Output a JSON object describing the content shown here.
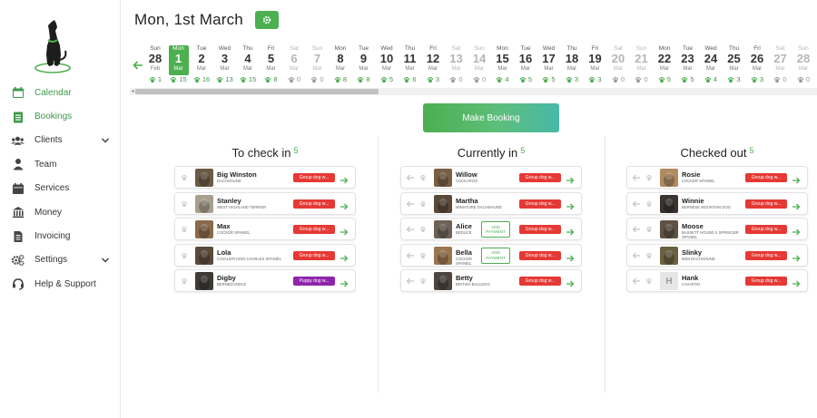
{
  "header": {
    "date_title": "Mon, 1st March"
  },
  "sidebar": {
    "items": [
      {
        "label": "Calendar",
        "icon": "calendar-icon",
        "active": true
      },
      {
        "label": "Bookings",
        "icon": "clipboard-icon",
        "active": true
      },
      {
        "label": "Clients",
        "icon": "users-icon",
        "expandable": true
      },
      {
        "label": "Team",
        "icon": "user-icon"
      },
      {
        "label": "Services",
        "icon": "services-calendar-icon"
      },
      {
        "label": "Money",
        "icon": "bank-icon"
      },
      {
        "label": "Invoicing",
        "icon": "invoice-icon"
      },
      {
        "label": "Settings",
        "icon": "cogs-icon",
        "expandable": true
      },
      {
        "label": "Help & Support",
        "icon": "headset-icon"
      }
    ]
  },
  "calendar": {
    "days": [
      {
        "dn": "Sun",
        "num": "28",
        "mo": "Feb",
        "count": "1",
        "weekend": false
      },
      {
        "dn": "Mon",
        "num": "1",
        "mo": "Mar",
        "count": "15",
        "selected": true
      },
      {
        "dn": "Tue",
        "num": "2",
        "mo": "Mar",
        "count": "16"
      },
      {
        "dn": "Wed",
        "num": "3",
        "mo": "Mar",
        "count": "13"
      },
      {
        "dn": "Thu",
        "num": "4",
        "mo": "Mar",
        "count": "15"
      },
      {
        "dn": "Fri",
        "num": "5",
        "mo": "Mar",
        "count": "8"
      },
      {
        "dn": "Sat",
        "num": "6",
        "mo": "Mar",
        "count": "0",
        "weekend": true
      },
      {
        "dn": "Sun",
        "num": "7",
        "mo": "Mar",
        "count": "0",
        "weekend": true
      },
      {
        "dn": "Mon",
        "num": "8",
        "mo": "Mar",
        "count": "8"
      },
      {
        "dn": "Tue",
        "num": "9",
        "mo": "Mar",
        "count": "8"
      },
      {
        "dn": "Wed",
        "num": "10",
        "mo": "Mar",
        "count": "5"
      },
      {
        "dn": "Thu",
        "num": "11",
        "mo": "Mar",
        "count": "6"
      },
      {
        "dn": "Fri",
        "num": "12",
        "mo": "Mar",
        "count": "3"
      },
      {
        "dn": "Sat",
        "num": "13",
        "mo": "Mar",
        "count": "0",
        "weekend": true
      },
      {
        "dn": "Sun",
        "num": "14",
        "mo": "Mar",
        "count": "0",
        "weekend": true
      },
      {
        "dn": "Mon",
        "num": "15",
        "mo": "Mar",
        "count": "4"
      },
      {
        "dn": "Tue",
        "num": "16",
        "mo": "Mar",
        "count": "5"
      },
      {
        "dn": "Wed",
        "num": "17",
        "mo": "Mar",
        "count": "5"
      },
      {
        "dn": "Thu",
        "num": "18",
        "mo": "Mar",
        "count": "3"
      },
      {
        "dn": "Fri",
        "num": "19",
        "mo": "Mar",
        "count": "3"
      },
      {
        "dn": "Sat",
        "num": "20",
        "mo": "Mar",
        "count": "0",
        "weekend": true
      },
      {
        "dn": "Sun",
        "num": "21",
        "mo": "Mar",
        "count": "0",
        "weekend": true
      },
      {
        "dn": "Mon",
        "num": "22",
        "mo": "Mar",
        "count": "5"
      },
      {
        "dn": "Tue",
        "num": "23",
        "mo": "Mar",
        "count": "5"
      },
      {
        "dn": "Wed",
        "num": "24",
        "mo": "Mar",
        "count": "4"
      },
      {
        "dn": "Thu",
        "num": "25",
        "mo": "Mar",
        "count": "3"
      },
      {
        "dn": "Fri",
        "num": "26",
        "mo": "Mar",
        "count": "3"
      },
      {
        "dn": "Sat",
        "num": "27",
        "mo": "Mar",
        "count": "0",
        "weekend": true
      },
      {
        "dn": "Sun",
        "num": "28",
        "mo": "Mar",
        "count": "0",
        "weekend": true
      }
    ]
  },
  "actions": {
    "make_booking": "Make Booking"
  },
  "columns": [
    {
      "title": "To check in",
      "count": "5",
      "cards": [
        {
          "name": "Big Winston",
          "breed": "Dachshund",
          "service": "Group dog w...",
          "photo": "#6b5a44"
        },
        {
          "name": "Stanley",
          "breed": "West Highland Terrier",
          "service": "Group dog w...",
          "photo": "#a89f8e"
        },
        {
          "name": "Max",
          "breed": "Cocker Spaniel",
          "service": "Group dog w...",
          "photo": "#8a6a4a"
        },
        {
          "name": "Lola",
          "breed": "Cavalier King Charles Spaniel",
          "service": "Group dog w...",
          "photo": "#5b4a3a"
        },
        {
          "name": "Digby",
          "breed": "Bernedoodle",
          "service": "Puppy dog w...",
          "photo": "#3e3a36",
          "puppy": true
        }
      ]
    },
    {
      "title": "Currently in",
      "count": "5",
      "cards": [
        {
          "name": "Willow",
          "breed": "Cockapoo",
          "service": "Group dog w...",
          "photo": "#7a5f45"
        },
        {
          "name": "Martha",
          "breed": "Miniature Dachshund",
          "service": "Group dog w...",
          "photo": "#5a4838"
        },
        {
          "name": "Alice",
          "breed": "Beduce",
          "service": "Group dog w...",
          "photo": "#6e6256",
          "add_payment": "ADD PAYMENT"
        },
        {
          "name": "Bella",
          "breed": "Cocker Spaniel",
          "service": "Group dog w...",
          "photo": "#9a7550",
          "add_payment": "ADD PAYMENT"
        },
        {
          "name": "Betty",
          "breed": "British Bulldog",
          "service": "Group dog w...",
          "photo": "#4e4540"
        }
      ]
    },
    {
      "title": "Checked out",
      "count": "5",
      "cards": [
        {
          "name": "Rosie",
          "breed": "Cocker Spaniel",
          "service": "Group dog w...",
          "photo": "#b08a60"
        },
        {
          "name": "Winnie",
          "breed": "Bernese Mountain Dog",
          "service": "Group dog w...",
          "photo": "#3a3330"
        },
        {
          "name": "Moose",
          "breed": "Bassett Hound x Springer Spaniel",
          "service": "Group dog w...",
          "photo": "#5f5245"
        },
        {
          "name": "Slinky",
          "breed": "Mini Dachshund",
          "service": "Group dog w...",
          "photo": "#6b6040"
        },
        {
          "name": "Hank",
          "breed": "Cavapoo",
          "service": "Group dog w...",
          "placeholder": "H"
        }
      ]
    }
  ],
  "colors": {
    "accent": "#4caf50",
    "service_red": "#e53935",
    "service_purple": "#8e24aa"
  }
}
